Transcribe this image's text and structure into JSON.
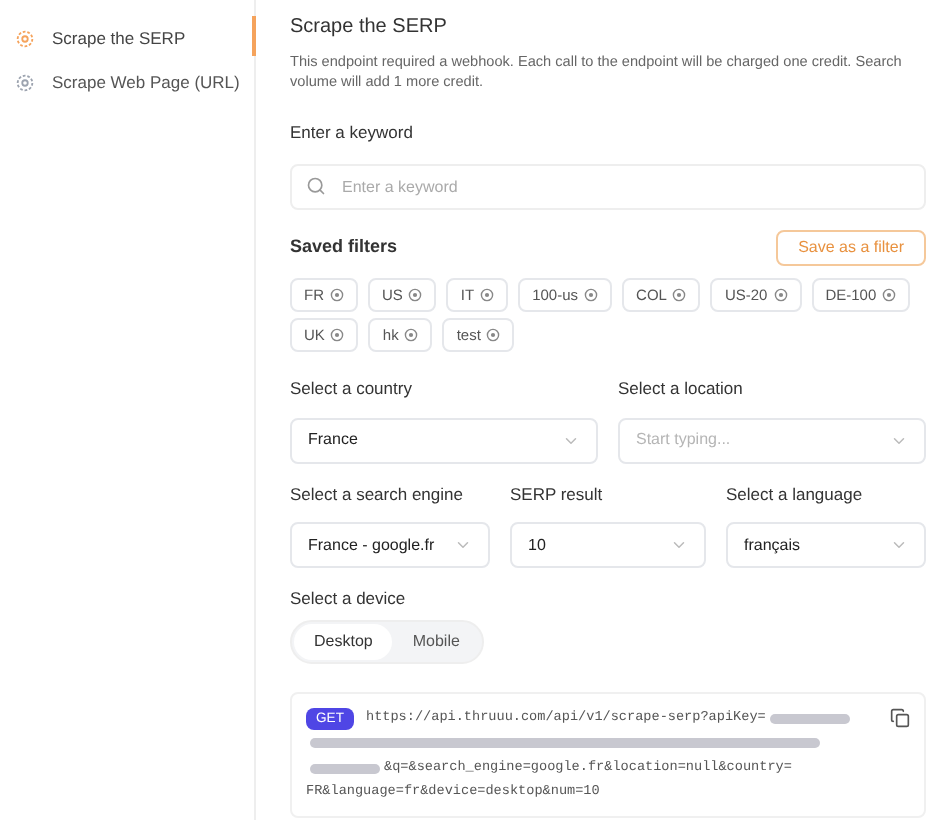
{
  "sidebar": {
    "items": [
      {
        "label": "Scrape the SERP",
        "selected": true
      },
      {
        "label": "Scrape Web Page (URL)",
        "selected": false
      }
    ]
  },
  "header": {
    "title": "Scrape the SERP",
    "description": "This endpoint required a webhook. Each call to the endpoint will be charged one credit. Search volume will add 1 more credit."
  },
  "keyword": {
    "label": "Enter a keyword",
    "placeholder": "Enter a keyword"
  },
  "saved_filters": {
    "title": "Saved filters",
    "save_button": "Save as a filter",
    "filters": [
      "FR",
      "US",
      "IT",
      "100-us",
      "COL",
      "US-20",
      "DE-100",
      "UK",
      "hk",
      "test"
    ]
  },
  "selects": [
    {
      "label": "Select a country",
      "value": "France"
    },
    {
      "label": "Select a location",
      "placeholder": "Start typing..."
    },
    {
      "label": "Select a search engine",
      "value": "France - google.fr"
    },
    {
      "label": "SERP result",
      "value": "10"
    },
    {
      "label": "Select a language",
      "value": "français"
    }
  ],
  "device": {
    "label": "Select a device",
    "options": [
      {
        "label": "Desktop",
        "selected": true
      },
      {
        "label": "Mobile",
        "selected": false
      }
    ]
  },
  "request": {
    "method": "GET",
    "url_start": "https://api.thruuu.com/api/v1/scrape-serp?apiKey=",
    "url_middle": "&q=&search_engine=google.fr&location=null&country=",
    "url_end": "FR&language=fr&device=desktop&num=10"
  }
}
